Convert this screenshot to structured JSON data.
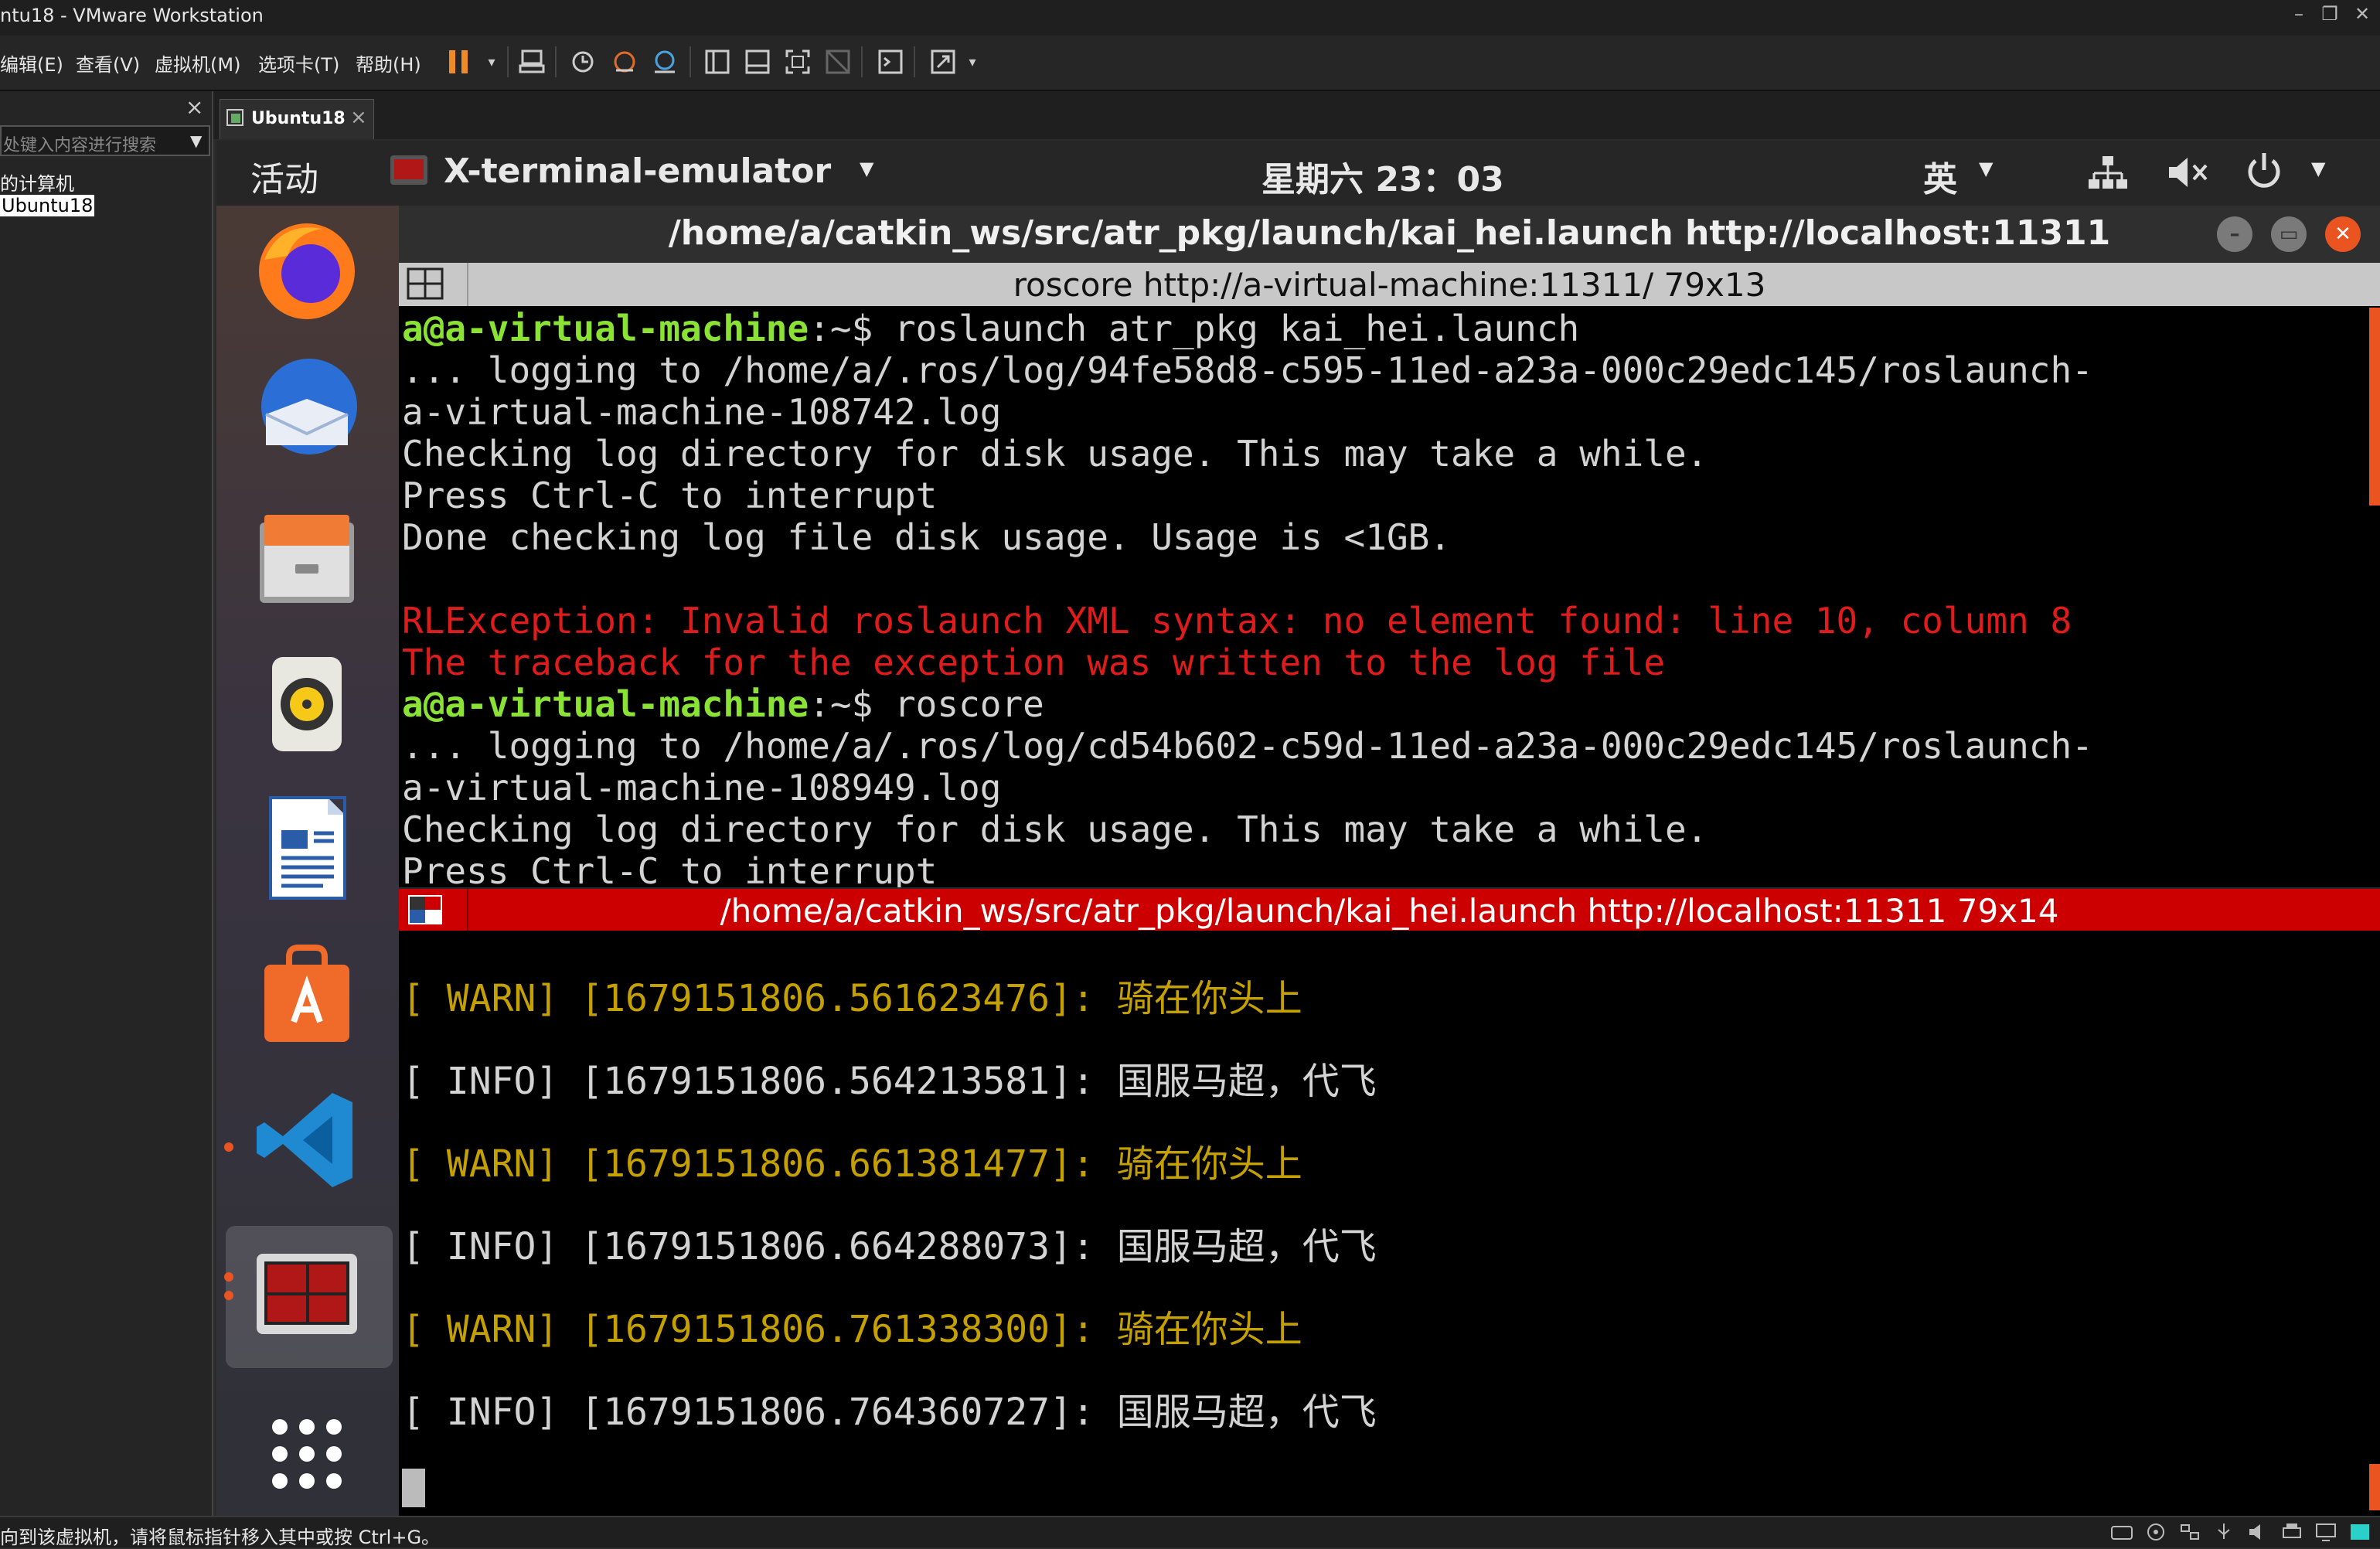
{
  "window": {
    "title": "ntu18 - VMware Workstation",
    "minimize_glyph": "–",
    "restore_glyph": "❐",
    "close_glyph": "✕"
  },
  "menu": {
    "items": [
      "编辑(E)",
      "查看(V)",
      "虚拟机(M)",
      "选项卡(T)",
      "帮助(H)"
    ]
  },
  "library": {
    "close_glyph": "×",
    "search_placeholder": "处键入内容进行搜索",
    "tree": [
      "的计算机",
      "Ubuntu18"
    ]
  },
  "tabs": [
    {
      "label": "Ubuntu18",
      "close_glyph": "×"
    }
  ],
  "guest_topbar": {
    "activities": "活动",
    "app_name": "X-terminal-emulator",
    "clock": "星期六 23：03",
    "input_method": "英"
  },
  "terminal": {
    "window_title": "/home/a/catkin_ws/src/atr_pkg/launch/kai_hei.launch http://localhost:11311",
    "pane1": {
      "header": "roscore http://a-virtual-machine:11311/ 79x13",
      "prompt_user": "a@a-virtual-machine",
      "prompt_path": ":~$ ",
      "cmd1": "roslaunch atr_pkg kai_hei.launch",
      "lines_a": [
        "... logging to /home/a/.ros/log/94fe58d8-c595-11ed-a23a-000c29edc145/roslaunch-",
        "a-virtual-machine-108742.log",
        "Checking log directory for disk usage. This may take a while.",
        "Press Ctrl-C to interrupt",
        "Done checking log file disk usage. Usage is <1GB."
      ],
      "errors": [
        "RLException: Invalid roslaunch XML syntax: no element found: line 10, column 8",
        "The traceback for the exception was written to the log file"
      ],
      "cmd2": "roscore",
      "lines_b": [
        "... logging to /home/a/.ros/log/cd54b602-c59d-11ed-a23a-000c29edc145/roslaunch-",
        "a-virtual-machine-108949.log",
        "Checking log directory for disk usage. This may take a while.",
        "Press Ctrl-C to interrupt"
      ]
    },
    "pane2": {
      "header": "/home/a/catkin_ws/src/atr_pkg/launch/kai_hei.launch http://localhost:11311 79x14",
      "logs": [
        {
          "level": "[ WARN]",
          "stamp": " [1679151806.561623476]: ",
          "msg": "骑在你头上"
        },
        {
          "level": "[ INFO]",
          "stamp": " [1679151806.564213581]: ",
          "msg": "国服马超，代飞"
        },
        {
          "level": "[ WARN]",
          "stamp": " [1679151806.661381477]: ",
          "msg": "骑在你头上"
        },
        {
          "level": "[ INFO]",
          "stamp": " [1679151806.664288073]: ",
          "msg": "国服马超，代飞"
        },
        {
          "level": "[ WARN]",
          "stamp": " [1679151806.761338300]: ",
          "msg": "骑在你头上"
        },
        {
          "level": "[ INFO]",
          "stamp": " [1679151806.764360727]: ",
          "msg": "国服马超，代飞"
        }
      ]
    }
  },
  "status": {
    "text": "向到该虚拟机，请将鼠标指针移入其中或按 Ctrl+G。"
  },
  "colors": {
    "prompt_green": "#8ae234",
    "error_red": "#e01b1b",
    "warn_yellow": "#c4a000",
    "active_header_red": "#cc0000",
    "ubuntu_orange": "#e95420"
  }
}
